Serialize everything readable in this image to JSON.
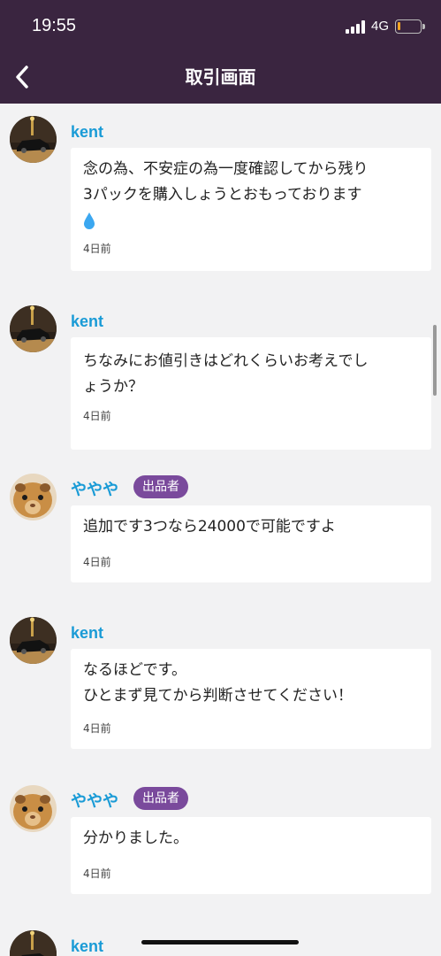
{
  "status_bar": {
    "time": "19:55",
    "network": "4G",
    "battery_level": 0.12
  },
  "header": {
    "title": "取引画面"
  },
  "messages": [
    {
      "sender": "kent",
      "avatar": "car-photo",
      "text": "念の為、不安症の為一度確認してから残り\n3パックを購入しょうとおもっております",
      "emoji": "droplet",
      "time": "4日前"
    },
    {
      "sender": "kent",
      "avatar": "car-photo",
      "text": "ちなみにお値引きはどれくらいお考えでし\nょうか？",
      "time": "4日前"
    },
    {
      "sender": "ややや",
      "avatar": "guinea-pig-photo",
      "badge": "出品者",
      "text": "追加です3つなら24000で可能ですよ",
      "time": "4日前"
    },
    {
      "sender": "kent",
      "avatar": "car-photo",
      "text": "なるほどです。\nひとまず見てから判断させてください！",
      "time": "4日前"
    },
    {
      "sender": "ややや",
      "avatar": "guinea-pig-photo",
      "badge": "出品者",
      "text": "分かりました。",
      "time": "4日前"
    },
    {
      "sender": "kent",
      "avatar": "car-photo"
    }
  ],
  "colors": {
    "header_bg": "#3a2540",
    "name": "#1a9bd6",
    "badge_bg": "#7a4a9c",
    "background": "#f2f2f3"
  }
}
